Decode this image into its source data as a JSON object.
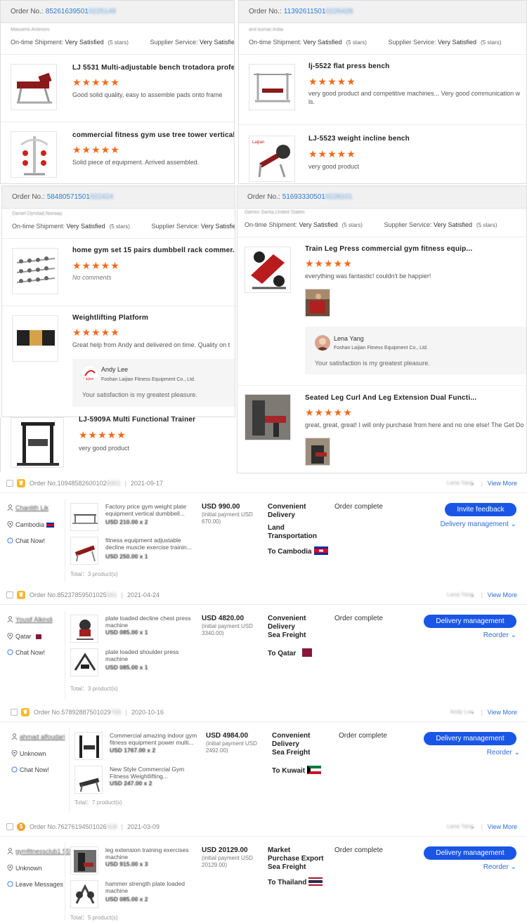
{
  "reviews": {
    "order_label": "Order No.:",
    "rating_labels": {
      "shipment": "On-time Shipment:",
      "supplier": "Supplier Service:",
      "value": "Very Satisfied",
      "stars": "(5 stars)"
    },
    "stars": "★★★★★",
    "cards": [
      {
        "order_prefix": "85261639501",
        "order_blur": "0225149",
        "buyer": "Massimo Antinoro",
        "products": [
          {
            "title": "LJ 5531 Multi-adjustable bench trotadora profe...",
            "comment": "Good solid quality, easy to assemble pads onto frame"
          },
          {
            "title": "commercial fitness gym use tree tower vertical...",
            "comment": "Solid piece of equipment. Arrived assembled."
          }
        ]
      },
      {
        "order_prefix": "11392611501",
        "order_blur": "0226428",
        "buyer": "anil kumar,India",
        "products": [
          {
            "title": "lj-5522 flat press bench",
            "comment": "very good product and competitive machines... Very good communication w",
            "comment2": "ls."
          },
          {
            "title": "LJ-5523 weight incline bench",
            "comment": "very good product"
          }
        ]
      },
      {
        "order_prefix": "58480571501",
        "order_blur": "022424",
        "buyer": "Daniel Dyrstad,Norway",
        "products": [
          {
            "title": "home gym set 15 pairs dumbbell rack commer...",
            "comment": "No comments"
          },
          {
            "title": "Weightlifting Platform",
            "comment": "Great help from Andy and delivered on time. Quality on t"
          }
        ],
        "reply": {
          "name": "Andy Lee",
          "company": "Foshan Laijian Fitness Equipment Co., Ltd.",
          "text": "Your satisfaction is my greatest pleasure."
        }
      },
      {
        "order_prefix": "51693330501",
        "order_blur": "0228101",
        "buyer": "Darren Santa,United States",
        "products": [
          {
            "title": "Train Leg Press commercial gym fitness equip...",
            "comment": "everything was fantastic!  couldn't be happier!"
          },
          {
            "title": "Seated Leg Curl And Leg Extension Dual Functi...",
            "comment": "great, great, great!  I will only purchase from here and no one else!  The Get Do"
          }
        ],
        "reply": {
          "name": "Lena Yang",
          "company": "Foshan Laijian Fitness Equipment Co., Ltd.",
          "text": "Your satisfaction is my greatest pleasure."
        }
      }
    ],
    "extra_product": {
      "title": "LJ-5909A  Multi Functional Trainer",
      "comment": "very good product"
    }
  },
  "orders": {
    "view_more": "View More",
    "chat": "Chat Now!",
    "leave_messages": "Leave Messages",
    "status": "Order complete",
    "items": [
      {
        "order_no": "Order No.10948582600102",
        "order_blur": "8301",
        "date": "2021-09-17",
        "staff": "Lena Yang",
        "user": "Chanlith Lik",
        "country": "Cambodia",
        "p1_name": "Factory price gym weight plate equipment vertical dumbbell...",
        "p1_price": "USD 210.00 x 2",
        "p2_name": "fitness equipment adjustable decline muscle exercise trainin...",
        "p2_price": "USD 250.00 x 1",
        "total": "Total：3 product(s)",
        "amount": "USD 990.00",
        "initial": "(initial payment USD 670.00)",
        "delivery": "Convenient Delivery",
        "method": "Land Transportation",
        "dest": "To Cambodia",
        "btn": "Invite feedback",
        "link": "Delivery management"
      },
      {
        "order_no": "Order No.85237859501025",
        "order_blur": "541",
        "date": "2021-04-24",
        "staff": "Lena Yang",
        "user": "Yousif Alkindi",
        "country": "Qatar",
        "p1_name": "plate loaded decline chest press machine",
        "p1_price": "USD 085.00 x 1",
        "p2_name": "plate loaded shoulder press machine",
        "p2_price": "USD 085.00 x 1",
        "total": "Total：3 product(s)",
        "amount": "USD 4820.00",
        "initial": "(initial payment USD 3340.00)",
        "delivery": "Convenient Delivery",
        "method": "Sea Freight",
        "dest": "To Qatar",
        "btn": "Delivery management",
        "link": "Reorder"
      },
      {
        "order_no": "Order No.57892887501029",
        "order_blur": "765",
        "date": "2020-10-16",
        "staff": "Andy Lee",
        "user": "ahmad alfoudari",
        "country": "Unknown",
        "p1_name": "Commercial amazing indoor gym fitness equipment power multi...",
        "p1_price": "USD 1767.00 x 2",
        "p2_name": "New Style Commercial Gym Fitness Weightlifting...",
        "p2_price": "USD 247.00 x 2",
        "total": "Total：7 product(s)",
        "amount": "USD 4984.00",
        "initial": "(initial payment USD 2492.00)",
        "delivery": "Convenient Delivery",
        "method": "Sea Freight",
        "dest": "To Kuwait",
        "btn": "Delivery management",
        "link": "Reorder"
      },
      {
        "order_no": "Order No.76276194501026",
        "order_blur": "318",
        "date": "2021-03-09",
        "staff": "Lena Yang",
        "user": "gymfitnessclub1 555",
        "country": "Unknown",
        "p1_name": "leg extension training exercises machine",
        "p1_price": "USD 915.00 x 3",
        "p2_name": "hammer strength plate loaded machine",
        "p2_price": "USD 085.00 x 2",
        "total": "Total：5 product(s)",
        "amount": "USD 20129.00",
        "initial": "(initial payment USD 20129.00)",
        "delivery": "Market Purchase Export",
        "method": "Sea Freight",
        "dest": "To Thailand",
        "btn": "Delivery management",
        "link": "Reorder",
        "contact": "leave"
      }
    ]
  }
}
